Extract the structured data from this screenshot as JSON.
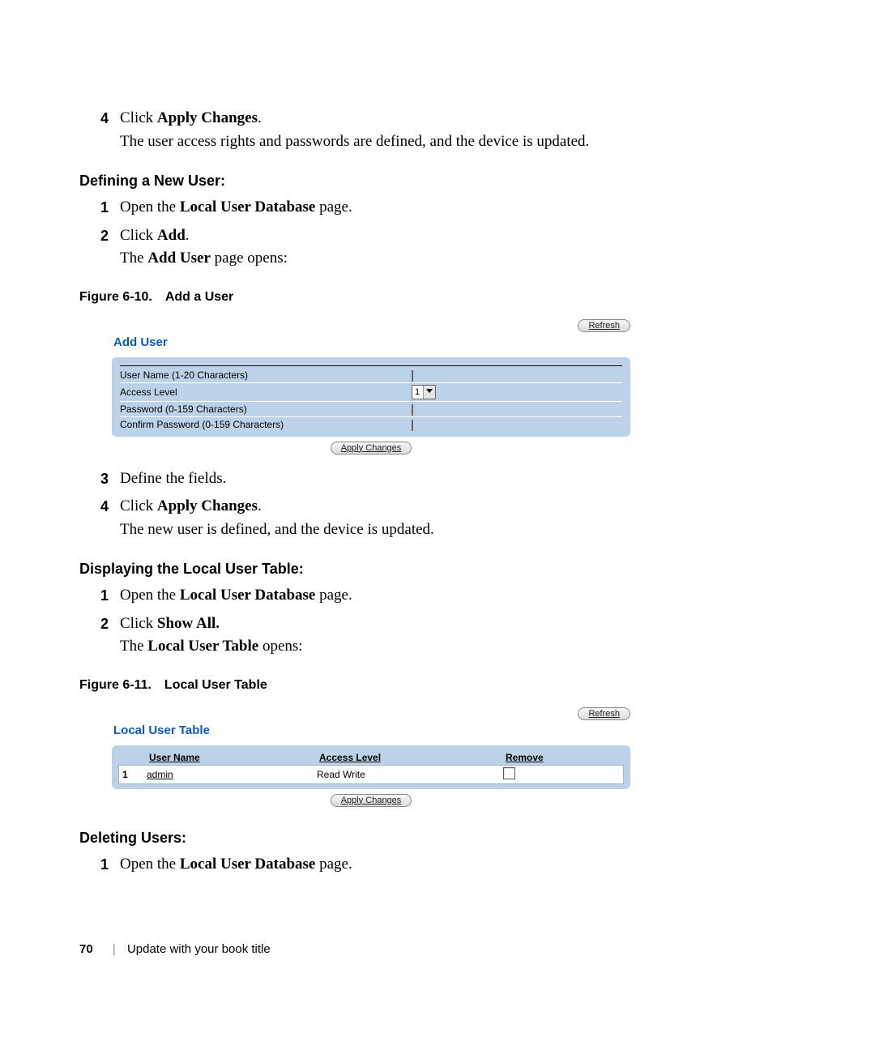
{
  "intro": {
    "step4_num": "4",
    "step4_prefix": "Click ",
    "step4_bold": "Apply Changes",
    "step4_suffix": ".",
    "step4_line2": "The user access rights and passwords are defined, and the device is updated."
  },
  "sectionA": {
    "heading": "Defining a New User:",
    "step1_num": "1",
    "step1_prefix": "Open the ",
    "step1_bold": "Local User Database",
    "step1_suffix": " page.",
    "step2_num": "2",
    "step2_prefix": "Click ",
    "step2_bold": "Add",
    "step2_suffix": ".",
    "step2_line2_prefix": "The ",
    "step2_line2_bold": "Add User",
    "step2_line2_suffix": " page opens:"
  },
  "fig10": {
    "num": "Figure 6-10.",
    "title": "Add a User"
  },
  "addUser": {
    "refresh": "Refresh",
    "title": "Add User",
    "row1": "User Name (1-20 Characters)",
    "row2": "Access Level",
    "row2_value": "1",
    "row3": "Password (0-159 Characters)",
    "row4": "Confirm Password (0-159 Characters)",
    "apply": "Apply Changes"
  },
  "sectionA2": {
    "step3_num": "3",
    "step3_text": "Define the fields.",
    "step4_num": "4",
    "step4_prefix": "Click ",
    "step4_bold": "Apply Changes",
    "step4_suffix": ".",
    "step4_line2": "The new user is defined, and the device is updated."
  },
  "sectionB": {
    "heading": "Displaying the Local User Table:",
    "step1_num": "1",
    "step1_prefix": "Open the ",
    "step1_bold": "Local User Database",
    "step1_suffix": " page.",
    "step2_num": "2",
    "step2_prefix": "Click ",
    "step2_bold": "Show All.",
    "step2_line2_prefix": "The ",
    "step2_line2_bold": "Local User Table",
    "step2_line2_suffix": " opens:"
  },
  "fig11": {
    "num": "Figure 6-11.",
    "title": "Local User Table"
  },
  "userTable": {
    "refresh": "Refresh",
    "title": "Local User Table",
    "hdr_user": "User Name",
    "hdr_access": "Access Level",
    "hdr_remove": "Remove",
    "row1_idx": "1",
    "row1_user": "admin",
    "row1_access": "Read Write",
    "apply": "Apply Changes"
  },
  "sectionC": {
    "heading": "Deleting Users:",
    "step1_num": "1",
    "step1_prefix": "Open the ",
    "step1_bold": "Local User Database",
    "step1_suffix": " page."
  },
  "footer": {
    "page": "70",
    "book": "Update with your book title"
  }
}
